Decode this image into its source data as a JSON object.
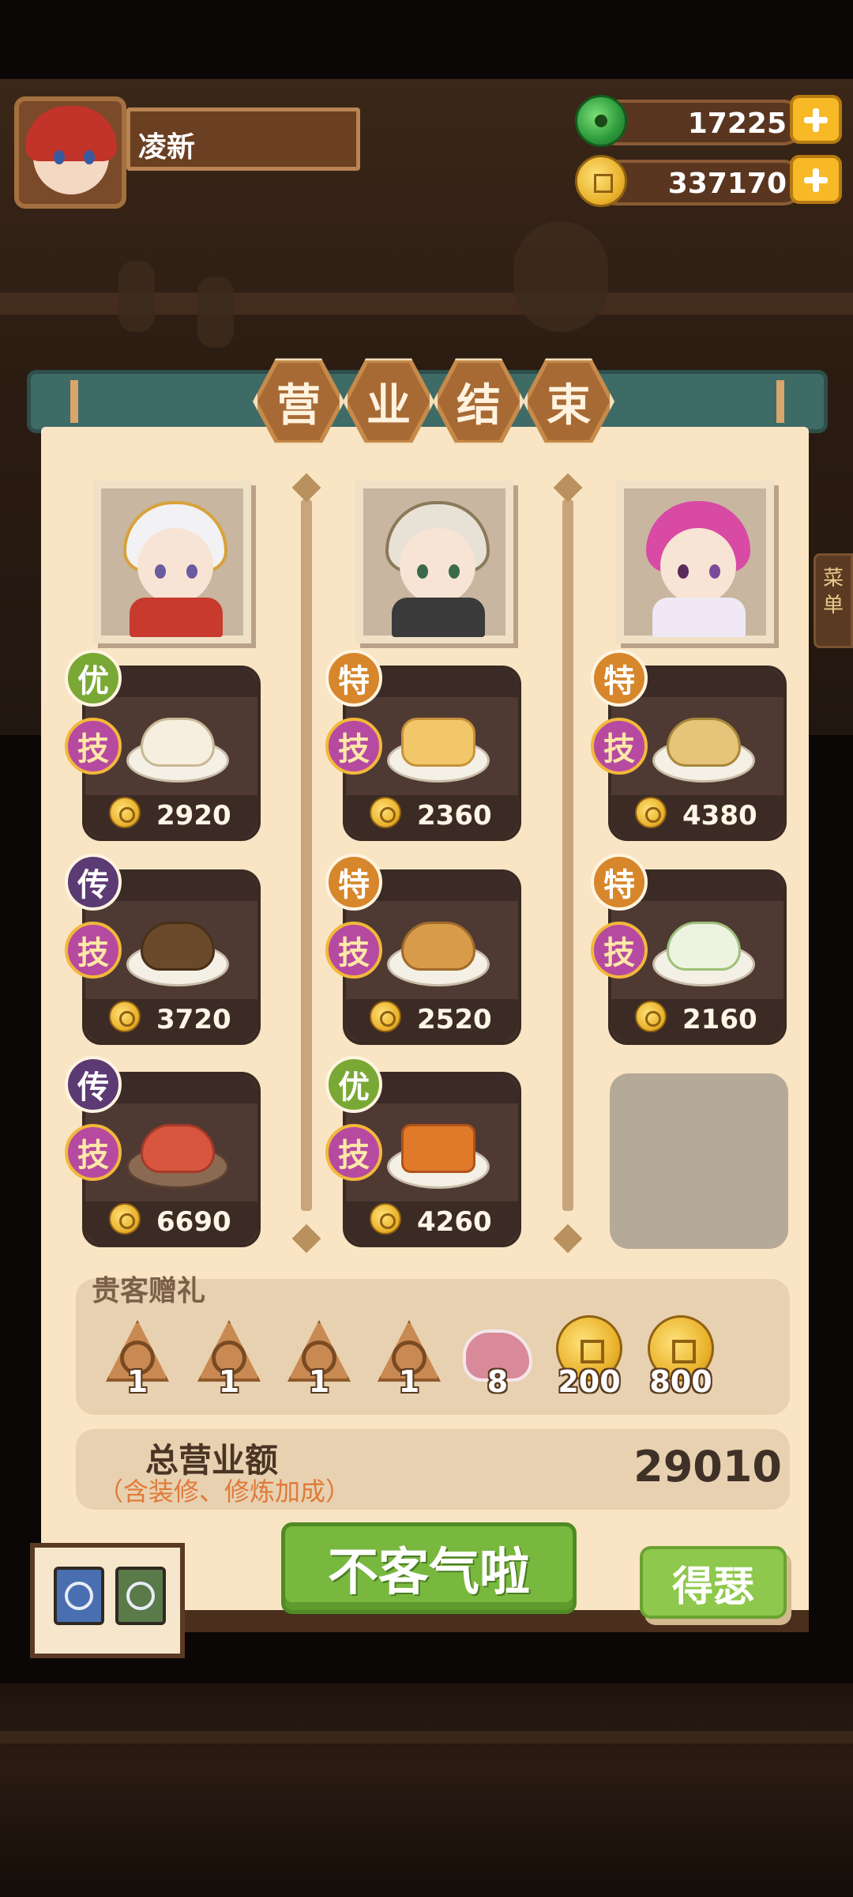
{
  "player": {
    "name": "凌新"
  },
  "currency": {
    "jade": {
      "amount": "17225"
    },
    "coins": {
      "amount": "337170"
    }
  },
  "side_tab": {
    "label": "菜单"
  },
  "title": {
    "chars": [
      "营",
      "业",
      "结",
      "束"
    ]
  },
  "chefs": [
    {
      "dishes": [
        {
          "grade": "优",
          "skill": "技",
          "price": "2920"
        },
        {
          "grade": "传",
          "skill": "技",
          "price": "3720"
        },
        {
          "grade": "传",
          "skill": "技",
          "price": "6690"
        }
      ]
    },
    {
      "dishes": [
        {
          "grade": "特",
          "skill": "技",
          "price": "2360"
        },
        {
          "grade": "特",
          "skill": "技",
          "price": "2520"
        },
        {
          "grade": "优",
          "skill": "技",
          "price": "4260"
        }
      ]
    },
    {
      "dishes": [
        {
          "grade": "特",
          "skill": "技",
          "price": "4380"
        },
        {
          "grade": "特",
          "skill": "技",
          "price": "2160"
        }
      ]
    }
  ],
  "gifts": {
    "title": "贵客赠礼",
    "items": [
      {
        "icon": "zongzi-icon",
        "count": "1"
      },
      {
        "icon": "zongzi-icon",
        "count": "1"
      },
      {
        "icon": "zongzi-icon",
        "count": "1"
      },
      {
        "icon": "zongzi-icon",
        "count": "1"
      },
      {
        "icon": "meat-icon",
        "count": "8"
      },
      {
        "icon": "coin-icon",
        "count": "200"
      },
      {
        "icon": "coin-icon",
        "count": "800"
      }
    ]
  },
  "total": {
    "label": "总营业额",
    "sub": "（含装修、修炼加成）",
    "value": "29010"
  },
  "buttons": {
    "main": "不客气啦",
    "side": "得瑟"
  },
  "colors": {
    "panel": "#f9e5c3",
    "card": "#4f3a33",
    "accent_green": "#78b83e",
    "title_bar": "#3f6b66"
  }
}
